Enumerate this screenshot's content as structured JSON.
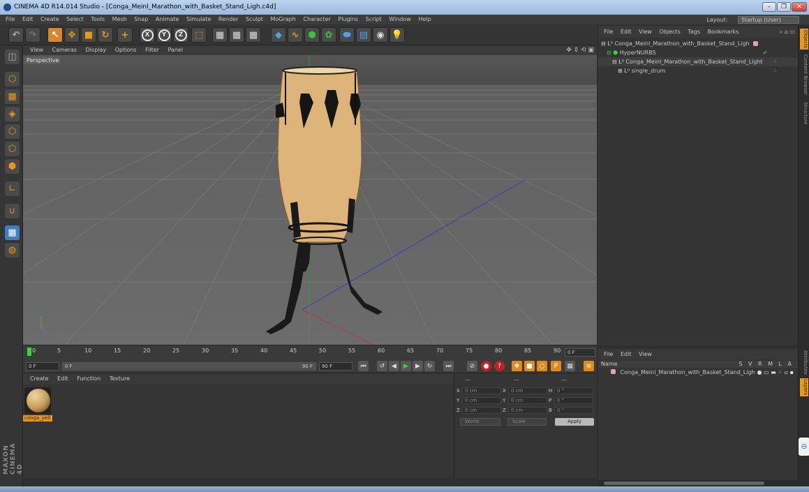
{
  "window": {
    "title": "CINEMA 4D R14.014 Studio - [Conga_Meinl_Marathon_with_Basket_Stand_Ligh.c4d]",
    "minimize": "–",
    "maximize": "❐",
    "close": "✕"
  },
  "menu": [
    "File",
    "Edit",
    "Create",
    "Select",
    "Tools",
    "Mesh",
    "Snap",
    "Animate",
    "Simulate",
    "Render",
    "Sculpt",
    "MoGraph",
    "Character",
    "Plugins",
    "Script",
    "Window",
    "Help"
  ],
  "layout": {
    "label": "Layout:",
    "value": "Startup (User)"
  },
  "viewport": {
    "menu": [
      "View",
      "Cameras",
      "Display",
      "Options",
      "Filter",
      "Panel"
    ],
    "camera_label": "Perspective"
  },
  "timeline": {
    "ticks": [
      "0",
      "5",
      "10",
      "15",
      "20",
      "25",
      "30",
      "35",
      "40",
      "45",
      "50",
      "55",
      "60",
      "65",
      "70",
      "75",
      "80",
      "85",
      "90"
    ],
    "current_frame": "0 F"
  },
  "transport": {
    "start": "0 F",
    "range_start": "0 F",
    "range_end": "90 F",
    "end": "90 F"
  },
  "material_panel": {
    "menu": [
      "Create",
      "Edit",
      "Function",
      "Texture"
    ],
    "materials": [
      {
        "label": "conga_yell"
      }
    ]
  },
  "coordinates": {
    "header_left": "---",
    "header_mid": "---",
    "header_right": "---",
    "rows": [
      {
        "a": "X",
        "av": "0 cm",
        "b": "X",
        "bv": "0 cm",
        "c": "H",
        "cv": "0 °"
      },
      {
        "a": "Y",
        "av": "0 cm",
        "b": "Y",
        "bv": "0 cm",
        "c": "P",
        "cv": "0 °"
      },
      {
        "a": "Z",
        "av": "0 cm",
        "b": "Z",
        "bv": "0 cm",
        "c": "B",
        "cv": "0 °"
      }
    ],
    "mode": "World",
    "type": "Scale",
    "apply": "Apply"
  },
  "objects_panel": {
    "menu": [
      "File",
      "Edit",
      "View",
      "Objects",
      "Tags",
      "Bookmarks"
    ],
    "items": [
      {
        "name": "Conga_Meinl_Marathon_with_Basket_Stand_Ligh",
        "indent": 0
      },
      {
        "name": "HyperNURBS",
        "indent": 1
      },
      {
        "name": "Conga_Meinl_Marathon_with_Basket_Stand_Light",
        "indent": 2
      },
      {
        "name": "single_drum",
        "indent": 3
      }
    ]
  },
  "layers_panel": {
    "menu": [
      "File",
      "Edit",
      "View"
    ],
    "col_name": "Name",
    "cols": "S V R M L A",
    "row": "Conga_Meinl_Marathon_with_Basket_Stand_Ligh"
  },
  "side_tabs": [
    "Objects",
    "Content Browser",
    "Structure",
    "Attributes",
    "Layers"
  ],
  "brand": "MAXON CINEMA 4D"
}
